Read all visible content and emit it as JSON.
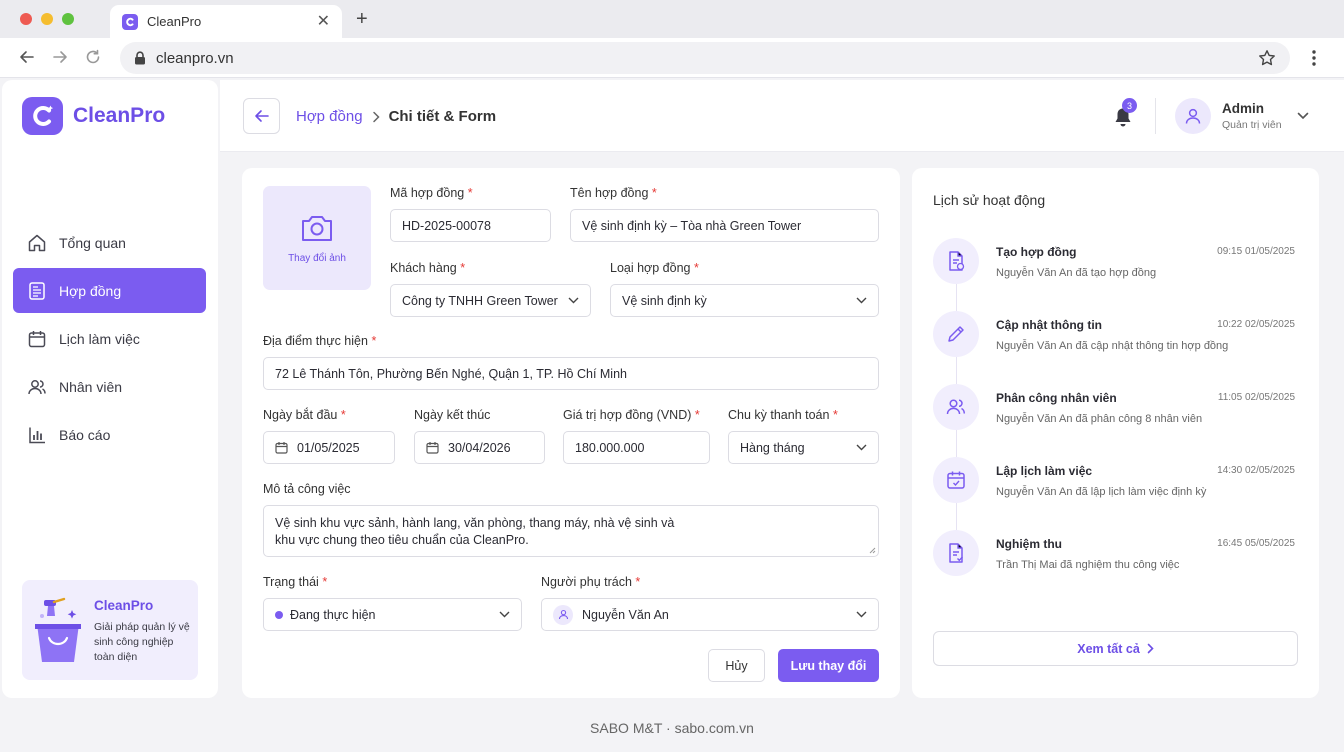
{
  "browser": {
    "tab_title": "CleanPro",
    "url": "cleanpro.vn"
  },
  "brand": {
    "name": "CleanPro",
    "accent": "#7b5cf0"
  },
  "sidebar": {
    "items": [
      {
        "label": "Tổng quan",
        "icon": "home-icon",
        "active": false
      },
      {
        "label": "Hợp đồng",
        "icon": "contract-icon",
        "active": true
      },
      {
        "label": "Lịch làm việc",
        "icon": "calendar-icon",
        "active": false
      },
      {
        "label": "Nhân viên",
        "icon": "users-icon",
        "active": false
      },
      {
        "label": "Báo cáo",
        "icon": "bar-chart-icon",
        "active": false
      }
    ],
    "promo": {
      "title": "CleanPro",
      "desc": "Giải pháp quản lý vệ sinh công nghiệp toàn diện"
    }
  },
  "header": {
    "crumb_parent": "Hợp đồng",
    "crumb_current": "Chi tiết & Form",
    "notif_count": "3",
    "user_name": "Admin",
    "user_role": "Quản trị viên"
  },
  "form": {
    "photo_label": "Thay đổi ảnh",
    "contract_code": {
      "label": "Mã hợp đồng",
      "value": "HD-2025-00078"
    },
    "contract_name": {
      "label": "Tên hợp đồng",
      "value": "Vệ sinh định kỳ – Tòa nhà Green Tower"
    },
    "customer": {
      "label": "Khách hàng",
      "value": "Công ty TNHH Green Tower"
    },
    "contract_type": {
      "label": "Loại hợp đồng",
      "value": "Vệ sinh định kỳ"
    },
    "location": {
      "label": "Địa điểm thực hiện",
      "value": "72 Lê Thánh Tôn, Phường Bến Nghé, Quận 1, TP. Hồ Chí Minh"
    },
    "start_date": {
      "label": "Ngày bắt đầu",
      "value": "01/05/2025"
    },
    "end_date": {
      "label": "Ngày kết thúc",
      "value": "30/04/2026"
    },
    "contract_value": {
      "label": "Giá trị hợp đồng (VND)",
      "value": "180.000.000"
    },
    "payment_cycle": {
      "label": "Chu kỳ thanh toán",
      "value": "Hàng tháng"
    },
    "description": {
      "label": "Mô tả công việc",
      "line1": "Vệ sinh khu vực sảnh, hành lang, văn phòng, thang máy, nhà vệ sinh và",
      "line2": "khu vực chung theo tiêu chuẩn của CleanPro."
    },
    "status": {
      "label": "Trạng thái",
      "value": "Đang thực hiện"
    },
    "owner": {
      "label": "Người phụ trách",
      "value": "Nguyễn Văn An"
    },
    "cancel_label": "Hủy",
    "save_label": "Lưu thay đổi"
  },
  "activity": {
    "title": "Lịch sử hoạt động",
    "events": [
      {
        "title": "Tạo hợp đồng",
        "desc": "Nguyễn Văn An đã tạo hợp đồng",
        "time": "09:15 01/05/2025",
        "icon": "document-plus-icon"
      },
      {
        "title": "Cập nhật thông tin",
        "desc": "Nguyễn Văn An đã cập nhật thông tin hợp đồng",
        "time": "10:22 02/05/2025",
        "icon": "pencil-icon"
      },
      {
        "title": "Phân công nhân viên",
        "desc": "Nguyễn Văn An đã phân công 8 nhân viên",
        "time": "11:05 02/05/2025",
        "icon": "users-icon"
      },
      {
        "title": "Lập lịch làm việc",
        "desc": "Nguyễn Văn An đã lập lịch làm việc định kỳ",
        "time": "14:30 02/05/2025",
        "icon": "calendar-icon"
      },
      {
        "title": "Nghiệm thu",
        "desc": "Trần Thị Mai đã nghiệm thu công việc",
        "time": "16:45 05/05/2025",
        "icon": "document-check-icon"
      }
    ],
    "view_all": "Xem tất cả"
  },
  "footer": {
    "text": "SABO M&T · sabo.com.vn"
  }
}
